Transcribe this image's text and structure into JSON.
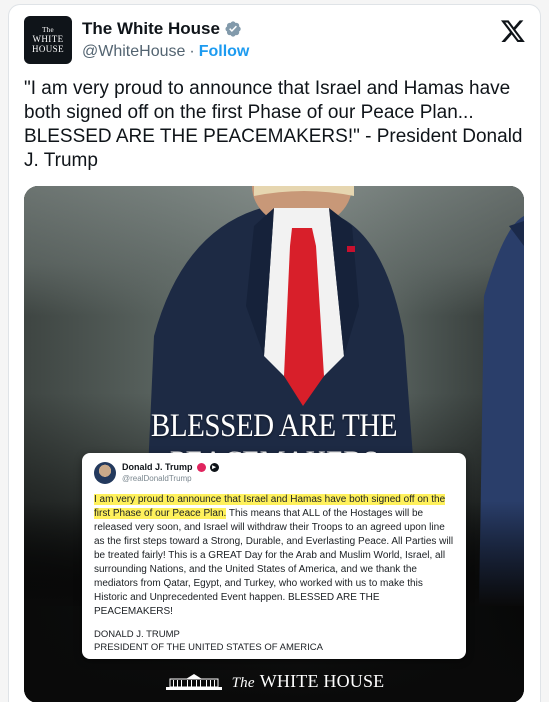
{
  "account": {
    "display_name": "The White House",
    "handle": "@WhiteHouse",
    "separator": "·",
    "follow_label": "Follow",
    "avatar_lines": [
      "The",
      "WHITE",
      "HOUSE"
    ]
  },
  "tweet": {
    "text": "\"I am very proud to announce that Israel and Hamas have both signed off on the first Phase of our Peace Plan... BLESSED ARE THE PEACEMAKERS!\" - President Donald J. Trump"
  },
  "media": {
    "headline": "BLESSED ARE THE PEACEMAKERS",
    "embedded_post": {
      "name": "Donald J. Trump",
      "handle": "@realDonaldTrump",
      "highlighted": "I am very proud to announce that Israel and Hamas have both signed off on the first Phase of our Peace Plan.",
      "rest": " This means that ALL of the Hostages will be released very soon, and Israel will withdraw their Troops to an agreed upon line as the first steps toward a Strong, Durable, and Everlasting Peace. All Parties will be treated fairly! This is a GREAT Day for the Arab and Muslim World, Israel, all surrounding Nations, and the United States of America, and we thank the mediators from Qatar, Egypt, and Turkey, who worked with us to make this Historic and Unprecedented Event happen. BLESSED ARE THE PEACEMAKERS!",
      "signature_name": "DONALD J. TRUMP",
      "signature_title": "PRESIDENT OF THE UNITED STATES OF AMERICA"
    },
    "brand_the": "The",
    "brand_name": "WHITE HOUSE"
  },
  "colors": {
    "follow": "#1d9bf0",
    "verified": "#829aab",
    "highlight": "#fff15c"
  },
  "icons": [
    "verified-badge-icon",
    "x-logo-icon",
    "white-house-building-icon"
  ]
}
